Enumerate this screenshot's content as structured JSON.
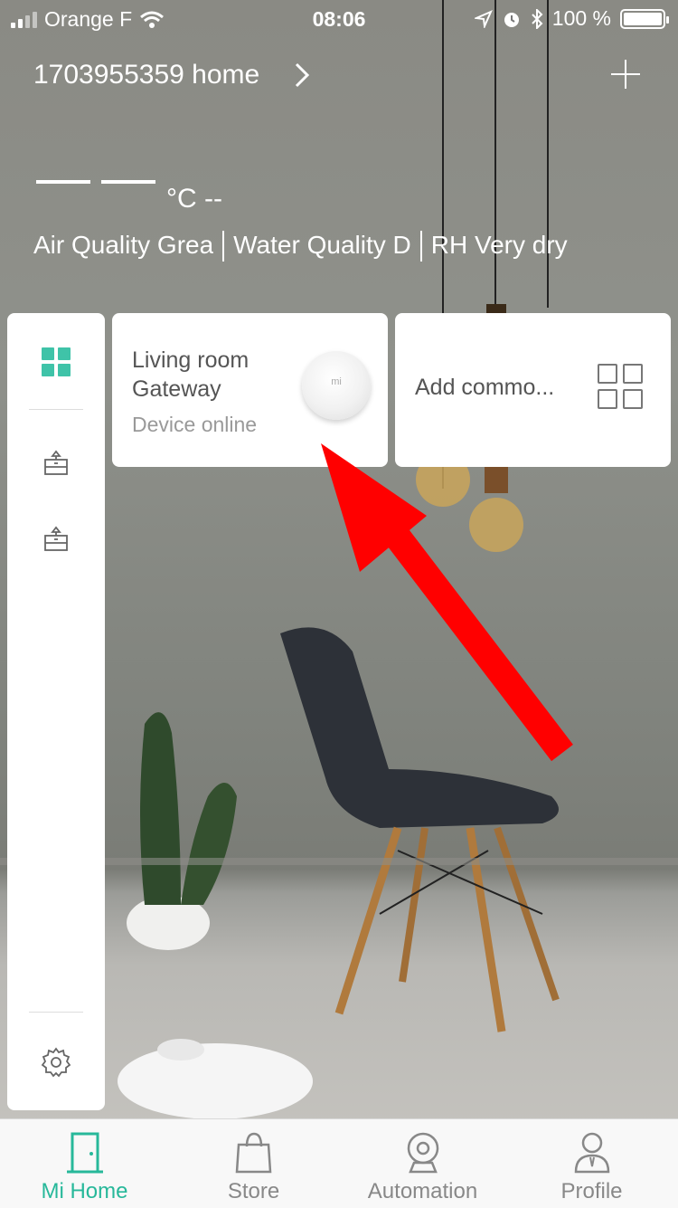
{
  "status_bar": {
    "carrier": "Orange F",
    "time": "08:06",
    "battery": "100 %",
    "battery_level": 1.0,
    "icons": [
      "signal-icon",
      "wifi-icon",
      "location-icon",
      "alarm-icon",
      "bluetooth-icon",
      "battery-icon"
    ]
  },
  "header": {
    "home_name": "1703955359 home",
    "chevron_icon": "chevron-right-icon",
    "add_icon": "plus-icon"
  },
  "environment": {
    "temperature_unit": "°C --",
    "items": [
      "Air Quality Grea",
      "Water Quality D",
      "RH Very dry"
    ]
  },
  "sidebar": {
    "items": [
      "all-devices-grid-icon",
      "room-furniture-icon",
      "room-furniture-icon",
      "settings-gear-icon"
    ]
  },
  "cards": {
    "gateway": {
      "name_line1": "Living room",
      "name_line2": "Gateway",
      "status": "Device online",
      "logo_text": "mi"
    },
    "add_common": {
      "label": "Add commo..."
    }
  },
  "tabbar": {
    "tabs": [
      {
        "label": "Mi Home",
        "icon": "door-icon",
        "active": true
      },
      {
        "label": "Store",
        "icon": "shopping-bag-icon",
        "active": false
      },
      {
        "label": "Automation",
        "icon": "camera-icon",
        "active": false
      },
      {
        "label": "Profile",
        "icon": "person-icon",
        "active": false
      }
    ]
  },
  "colors": {
    "accent": "#27b89a",
    "annotation_arrow": "#ff0000",
    "card_bg": "#ffffff"
  }
}
